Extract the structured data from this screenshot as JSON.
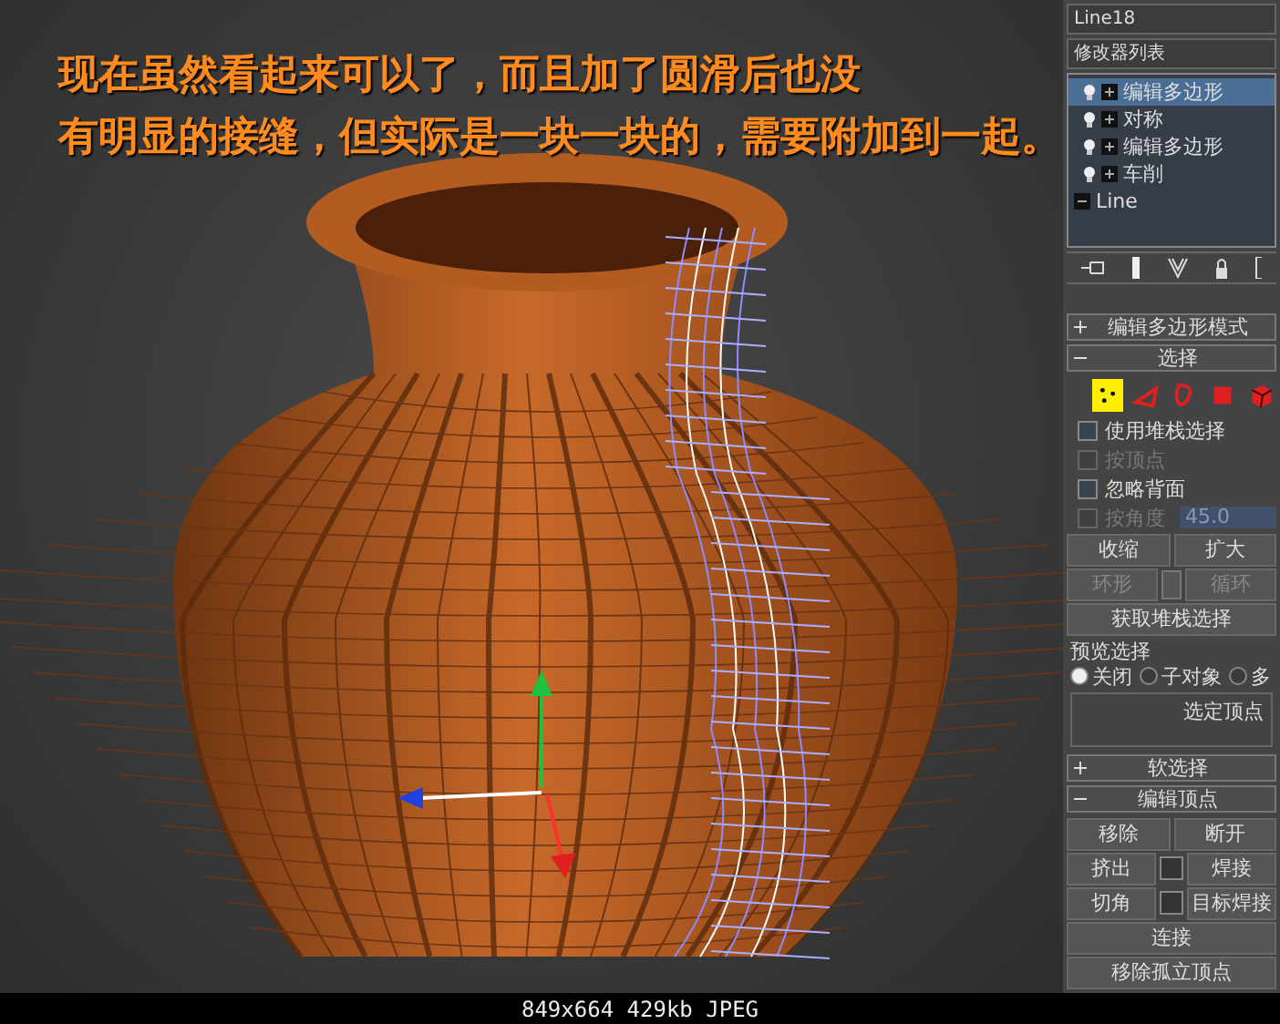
{
  "annotation": {
    "lines": [
      "现在虽然看起来可以了，而且加了圆滑后也没",
      "有明显的接缝，但实际是一块一块的，需要附加到一起。"
    ]
  },
  "panel": {
    "object_name": "Line18",
    "modifier_list": "修改器列表",
    "stack": [
      {
        "label": "编辑多边形",
        "kind": "modifier",
        "selected": true
      },
      {
        "label": "对称",
        "kind": "modifier",
        "selected": false
      },
      {
        "label": "编辑多边形",
        "kind": "modifier",
        "selected": false
      },
      {
        "label": "车削",
        "kind": "modifier",
        "selected": false
      },
      {
        "label": "Line",
        "kind": "base",
        "selected": false
      }
    ],
    "rollouts": [
      {
        "title": "编辑多边形模式",
        "expanded": false
      },
      {
        "title": "选择",
        "expanded": true,
        "items": [
          {
            "kind": "modes",
            "modes": [
              {
                "kind": "vertex",
                "selected": true
              },
              {
                "kind": "edge",
                "selected": false
              },
              {
                "kind": "border",
                "selected": false
              },
              {
                "kind": "polygon",
                "selected": false
              },
              {
                "kind": "element",
                "selected": false
              }
            ]
          },
          {
            "kind": "checkbox",
            "label": "使用堆栈选择",
            "checked": false,
            "disabled": false
          },
          {
            "kind": "checkbox",
            "label": "按顶点",
            "checked": false,
            "disabled": true
          },
          {
            "kind": "checkbox",
            "label": "忽略背面",
            "checked": false,
            "disabled": false
          },
          {
            "kind": "checkbox",
            "label": "按角度",
            "checked": false,
            "disabled": true,
            "value": "45.0"
          },
          {
            "kind": "buttons",
            "buttons": [
              {
                "label": "收缩",
                "disabled": false
              },
              {
                "label": "扩大",
                "disabled": false
              }
            ]
          },
          {
            "kind": "buttons",
            "spinner": true,
            "buttons": [
              {
                "label": "环形",
                "disabled": true
              },
              {
                "label": "循环",
                "disabled": true
              }
            ]
          },
          {
            "kind": "buttons",
            "buttons": [
              {
                "label": "获取堆栈选择",
                "disabled": false
              }
            ]
          },
          {
            "kind": "group",
            "title": "预览选择",
            "radios": [
              {
                "label": "关闭",
                "selected": true
              },
              {
                "label": "子对象",
                "selected": false
              },
              {
                "label": "多",
                "selected": false
              }
            ]
          },
          {
            "kind": "info",
            "text": "选定顶点"
          }
        ]
      },
      {
        "title": "软选择",
        "expanded": false
      },
      {
        "title": "编辑顶点",
        "expanded": true,
        "items": [
          {
            "kind": "buttons",
            "buttons": [
              {
                "label": "移除",
                "disabled": false
              },
              {
                "label": "断开",
                "disabled": false
              }
            ]
          },
          {
            "kind": "buttons",
            "buttons": [
              {
                "label": "挤出",
                "disabled": false,
                "settings": true
              },
              {
                "label": "焊接",
                "disabled": false
              }
            ]
          },
          {
            "kind": "buttons",
            "buttons": [
              {
                "label": "切角",
                "disabled": false,
                "settings": true
              },
              {
                "label": "目标焊接",
                "disabled": false
              }
            ]
          },
          {
            "kind": "buttons",
            "buttons": [
              {
                "label": "连接",
                "disabled": false
              }
            ]
          },
          {
            "kind": "buttons",
            "buttons": [
              {
                "label": "移除孤立顶点",
                "disabled": false
              }
            ]
          }
        ]
      }
    ]
  },
  "caption": "849x664 429kb JPEG"
}
